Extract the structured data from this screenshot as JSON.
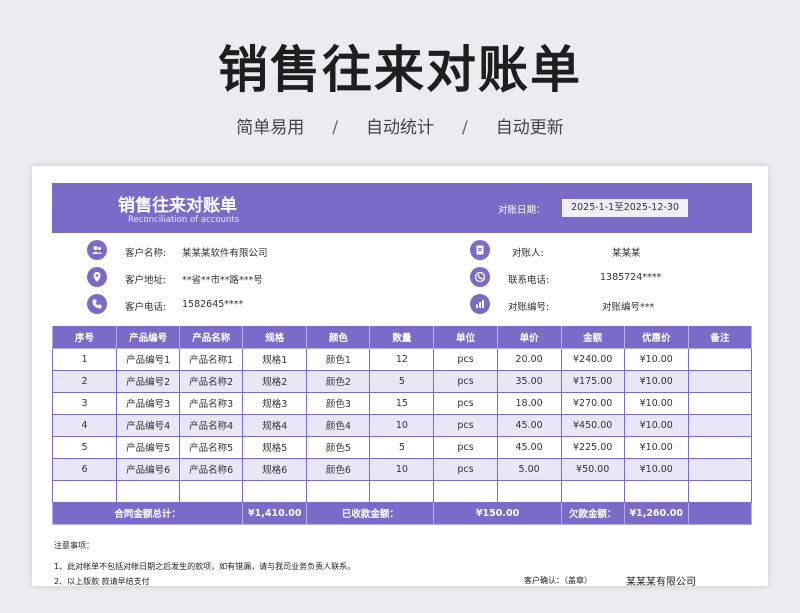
{
  "hero": {
    "title": "销售往来对账单",
    "features": [
      "简单易用",
      "自动统计",
      "自动更新"
    ],
    "separator": "/"
  },
  "sheet": {
    "title": "销售往来对账单",
    "subtitle_en": "Reconciliation of accounts",
    "date_label": "对账日期：",
    "date_value": "2025-1-1至2025-12-30",
    "info_left": [
      {
        "icon": "users-icon",
        "label": "客户名称:",
        "value": "某某某软件有限公司"
      },
      {
        "icon": "location-pin-icon",
        "label": "客户地址:",
        "value": "**省**市**路***号"
      },
      {
        "icon": "phone-icon",
        "label": "客户电话:",
        "value": "1582645****"
      }
    ],
    "info_right": [
      {
        "icon": "document-icon",
        "label": "对账人:",
        "value": "某某某"
      },
      {
        "icon": "contact-phone-icon",
        "label": "联系电话:",
        "value": "1385724****"
      },
      {
        "icon": "chart-icon",
        "label": "对账编号:",
        "value": "对账编号***"
      }
    ],
    "table": {
      "headers": [
        "序号",
        "产品编号",
        "产品名称",
        "规格",
        "颜色",
        "数量",
        "单位",
        "单价",
        "金额",
        "优惠价",
        "备注"
      ],
      "rows": [
        [
          "1",
          "产品编号1",
          "产品名称1",
          "规格1",
          "颜色1",
          "12",
          "pcs",
          "20.00",
          "¥240.00",
          "¥10.00",
          ""
        ],
        [
          "2",
          "产品编号2",
          "产品名称2",
          "规格2",
          "颜色2",
          "5",
          "pcs",
          "35.00",
          "¥175.00",
          "¥10.00",
          ""
        ],
        [
          "3",
          "产品编号3",
          "产品名称3",
          "规格3",
          "颜色3",
          "15",
          "pcs",
          "18.00",
          "¥270.00",
          "¥10.00",
          ""
        ],
        [
          "4",
          "产品编号4",
          "产品名称4",
          "规格4",
          "颜色4",
          "10",
          "pcs",
          "45.00",
          "¥450.00",
          "¥10.00",
          ""
        ],
        [
          "5",
          "产品编号5",
          "产品名称5",
          "规格5",
          "颜色5",
          "5",
          "pcs",
          "45.00",
          "¥225.00",
          "¥10.00",
          ""
        ],
        [
          "6",
          "产品编号6",
          "产品名称6",
          "规格6",
          "颜色6",
          "10",
          "pcs",
          "5.00",
          "¥50.00",
          "¥10.00",
          ""
        ],
        [
          "",
          "",
          "",
          "",
          "",
          "",
          "",
          "",
          "",
          "",
          ""
        ]
      ],
      "totals": {
        "contract_label": "合同金额总计：",
        "contract_value": "¥1,410.00",
        "received_label": "已收款金额：",
        "received_value": "¥150.00",
        "owed_label": "欠款金额：",
        "owed_value": "¥1,260.00"
      }
    },
    "notes": {
      "title": "注意事项：",
      "items": [
        "1、此对帐单不包括对帐日期之后发生的款项，如有错漏，请与我司业务负责人联系。",
        "2、以上版款 款请早结支付"
      ],
      "confirm_label": "客户确认：（盖章）",
      "company": "某某某有限公司"
    }
  },
  "colors": {
    "accent": "#7b6bc9",
    "alt_row": "#e9e6f8",
    "date_box": "#f1eef9"
  }
}
